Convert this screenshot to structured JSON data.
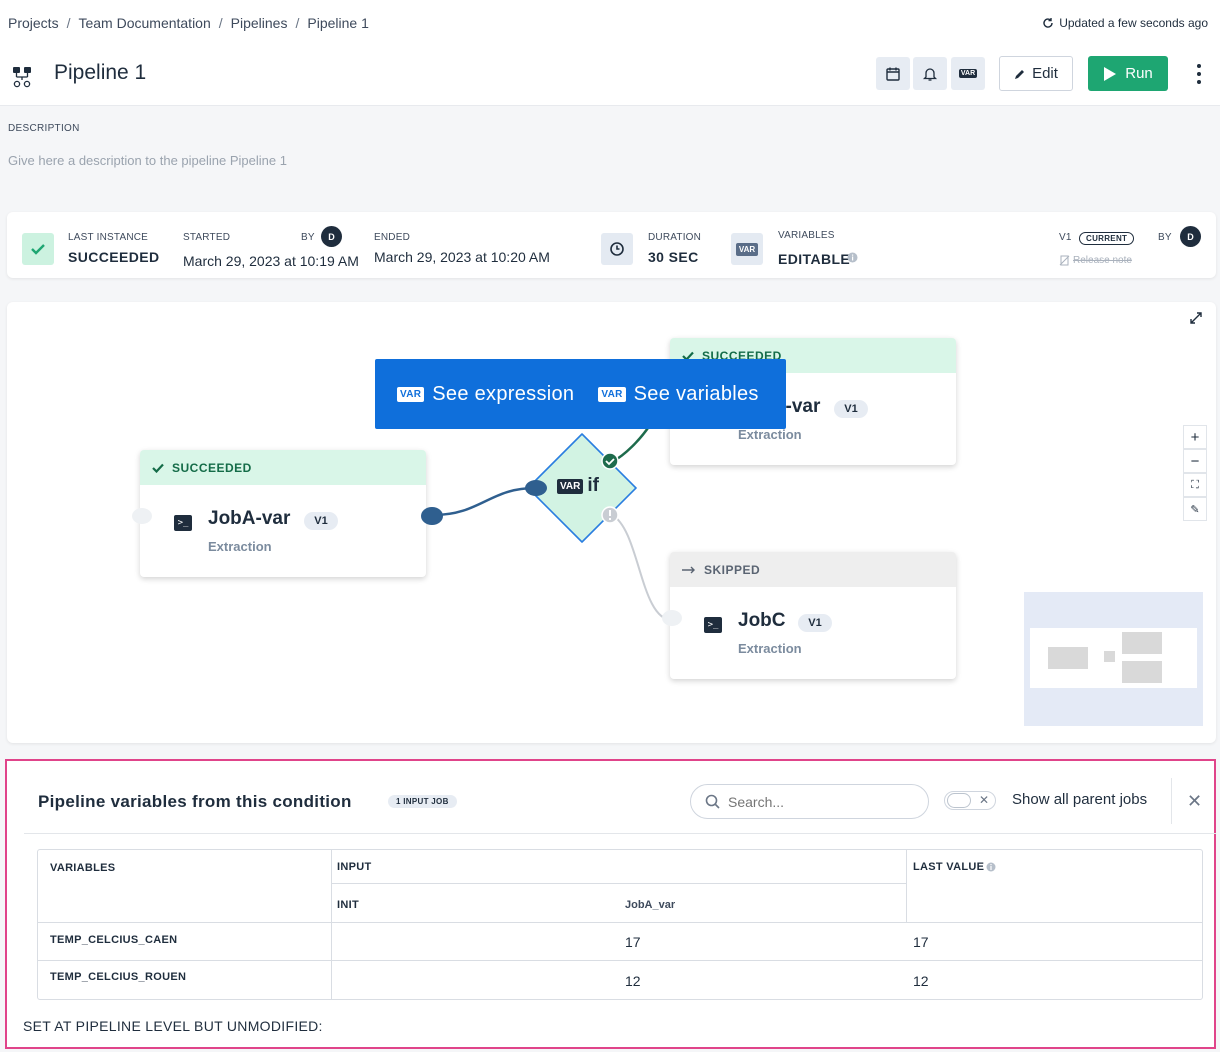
{
  "header": {
    "breadcrumb": [
      "Projects",
      "Team Documentation",
      "Pipelines",
      "Pipeline 1"
    ],
    "updated_text": "Updated a few seconds ago",
    "title": "Pipeline 1",
    "toolbar_var_label": "VAR",
    "edit_label": "Edit",
    "run_label": "Run"
  },
  "description": {
    "label": "DESCRIPTION",
    "placeholder": "Give here a description to the pipeline Pipeline 1"
  },
  "instance": {
    "last_instance_label": "LAST INSTANCE",
    "last_instance_value": "SUCCEEDED",
    "started_label": "STARTED",
    "started_value": "March 29, 2023 at 10:19 AM",
    "by_label": "BY",
    "started_by_initial": "D",
    "ended_label": "ENDED",
    "ended_value": "March 29, 2023 at 10:20 AM",
    "duration_label": "DURATION",
    "duration_value": "30 SEC",
    "variables_icon_label": "VAR",
    "variables_label": "VARIABLES",
    "variables_value": "EDITABLE",
    "version": "V1",
    "current_badge": "CURRENT",
    "version_by_label": "BY",
    "version_by_initial": "D",
    "release_note": "Release note"
  },
  "canvas": {
    "tooltip": {
      "var_chip": "VAR",
      "see_expression": "See expression",
      "see_variables": "See variables"
    },
    "condition": {
      "var_chip": "VAR",
      "label": "if"
    },
    "jobs": [
      {
        "status": "SUCCEEDED",
        "name": "JobA-var",
        "version": "V1",
        "type": "Extraction"
      },
      {
        "status": "SUCCEEDED",
        "name": "JobB-var",
        "version": "V1",
        "type": "Extraction"
      },
      {
        "status": "SKIPPED",
        "name": "JobC",
        "version": "V1",
        "type": "Extraction"
      }
    ],
    "zoom_controls": [
      "+",
      "−",
      "⛶",
      "✎"
    ]
  },
  "panel": {
    "title": "Pipeline variables from this condition",
    "input_badge": "1 INPUT JOB",
    "search_placeholder": "Search...",
    "toggle_label": "Show all parent jobs",
    "table": {
      "col_variables": "VARIABLES",
      "col_input": "INPUT",
      "col_last_value": "LAST VALUE",
      "sub_init": "INIT",
      "sub_joba": "JobA_var",
      "rows": [
        {
          "name": "TEMP_CELCIUS_CAEN",
          "init": "",
          "joba": "17",
          "last": "17"
        },
        {
          "name": "TEMP_CELCIUS_ROUEN",
          "init": "",
          "joba": "12",
          "last": "12"
        }
      ]
    },
    "unmodified_label": "SET AT PIPELINE LEVEL BUT UNMODIFIED:"
  },
  "colors": {
    "success": "#1ea672",
    "accent_blue": "#0f6fdb",
    "highlight_border": "#e0448a",
    "text_dark": "#1f2d3d"
  }
}
